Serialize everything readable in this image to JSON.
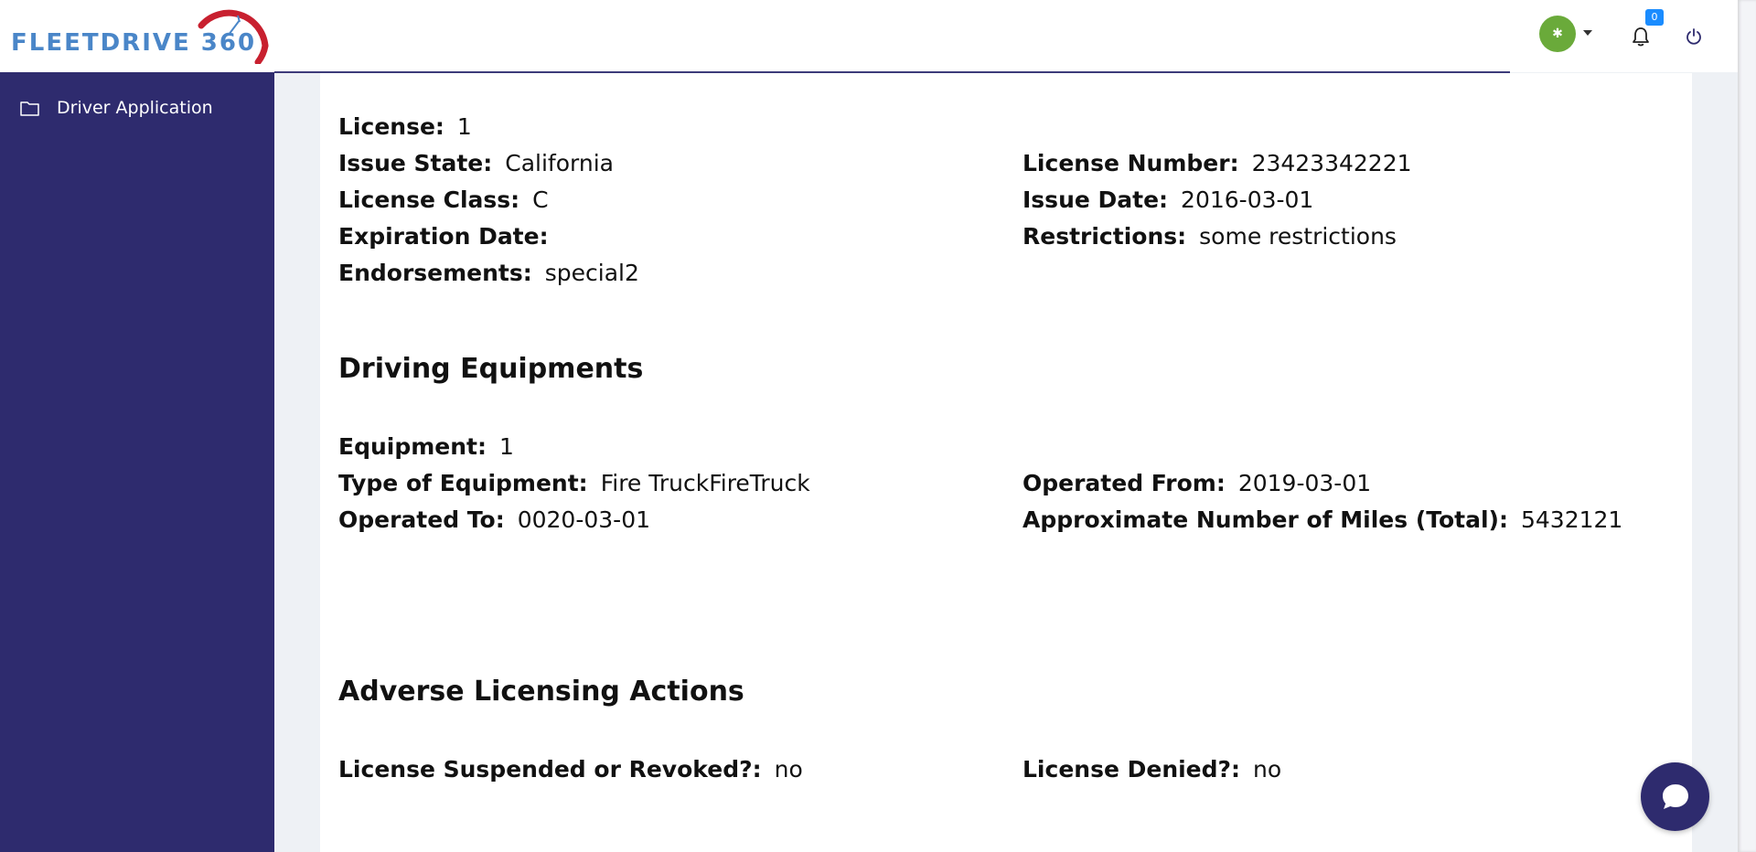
{
  "header": {
    "logo_text": "FLEETDRIVE 360",
    "avatar_text": "✱",
    "notifications_count": "0"
  },
  "sidebar": {
    "items": [
      {
        "label": "Driver Application",
        "icon": "folder-icon"
      }
    ]
  },
  "license": {
    "title_label": "License:",
    "title_value": "1",
    "issue_state_label": "Issue State:",
    "issue_state": "California",
    "license_number_label": "License Number:",
    "license_number": "23423342221",
    "license_class_label": "License Class:",
    "license_class": "C",
    "issue_date_label": "Issue Date:",
    "issue_date": "2016-03-01",
    "expiration_date_label": "Expiration Date:",
    "expiration_date": "",
    "restrictions_label": "Restrictions:",
    "restrictions": "some restrictions",
    "endorsements_label": "Endorsements:",
    "endorsements": "special2"
  },
  "equipment": {
    "section_title": "Driving Equipments",
    "title_label": "Equipment:",
    "title_value": "1",
    "type_label": "Type of Equipment:",
    "type": "Fire TruckFireTruck",
    "operated_from_label": "Operated From:",
    "operated_from": "2019-03-01",
    "operated_to_label": "Operated To:",
    "operated_to": "0020-03-01",
    "miles_label": "Approximate Number of Miles (Total):",
    "miles": "5432121"
  },
  "adverse": {
    "section_title": "Adverse Licensing Actions",
    "suspended_label": "License Suspended or Revoked?:",
    "suspended": "no",
    "denied_label": "License Denied?:",
    "denied": "no"
  },
  "colors": {
    "sidebar": "#2e2b6e",
    "logo_blue": "#4a86c8",
    "logo_red": "#c8202f",
    "avatar": "#6aaa3a",
    "badge": "#1a8cff"
  }
}
